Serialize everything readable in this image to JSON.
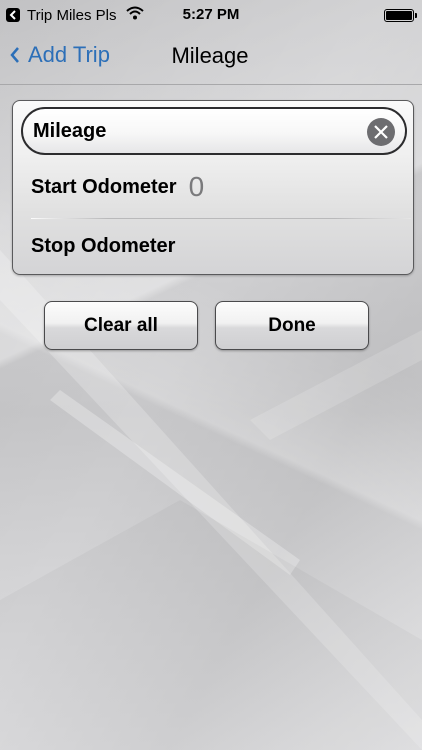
{
  "status_bar": {
    "back_app": "Trip Miles Pls",
    "time": "5:27 PM"
  },
  "nav": {
    "back_label": "Add Trip",
    "title": "Mileage"
  },
  "form": {
    "mileage_label": "Mileage",
    "start_label": "Start Odometer",
    "start_value": "0",
    "stop_label": "Stop Odometer"
  },
  "buttons": {
    "clear_all": "Clear all",
    "done": "Done"
  },
  "colors": {
    "accent": "#2c6fb8",
    "clear_icon": "#6d6d70"
  }
}
